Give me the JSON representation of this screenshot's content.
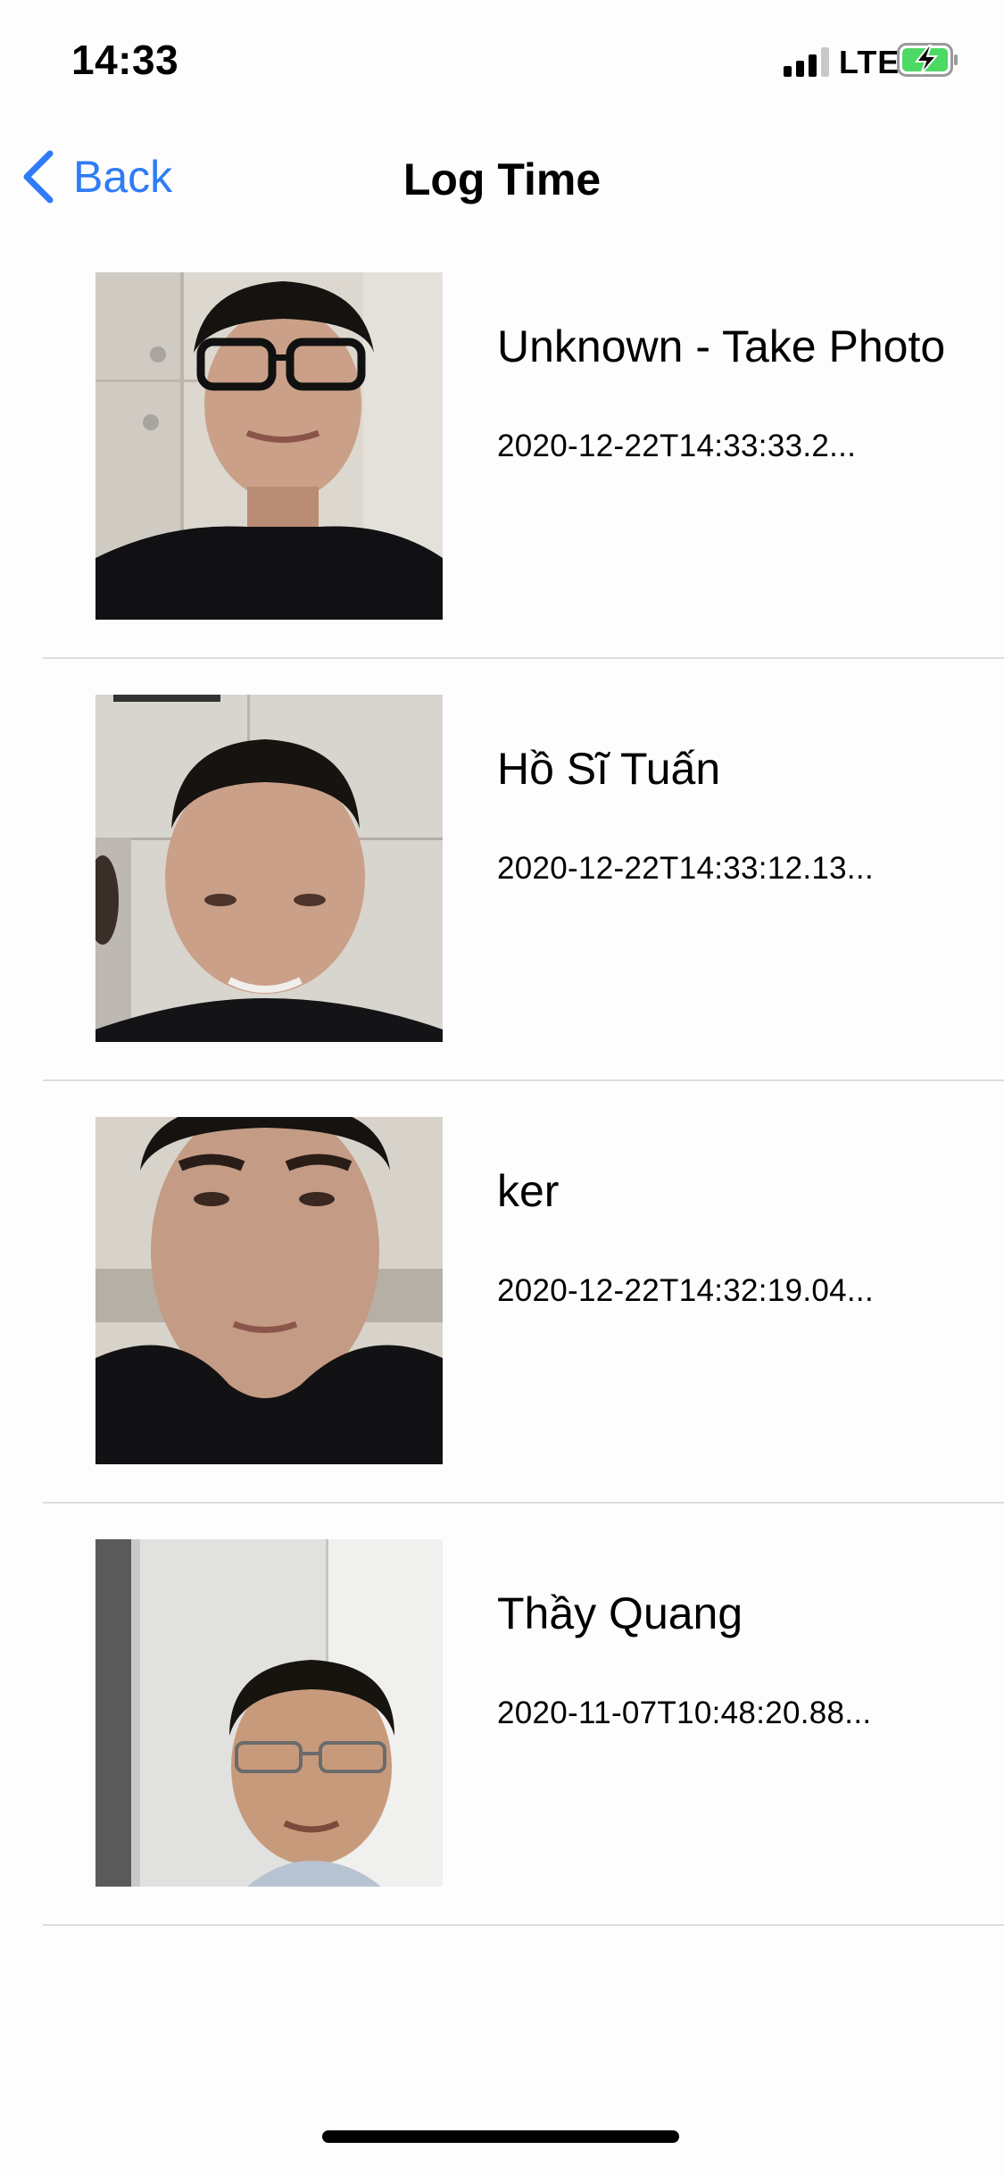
{
  "status_bar": {
    "time": "14:33",
    "network": "LTE",
    "signal_bars_active": 3,
    "battery_state": "charging",
    "battery_color": "#4cd964"
  },
  "nav": {
    "back_label": "Back",
    "back_icon": "chevron-left-icon",
    "title": "Log Time",
    "tint_color": "#2f7cf6"
  },
  "logs": [
    {
      "name": "Unknown - Take Photo",
      "time": "2020-12-22T14:33:33.2..."
    },
    {
      "name": "Hồ Sĩ Tuấn",
      "time": "2020-12-22T14:33:12.13..."
    },
    {
      "name": "ker",
      "time": "2020-12-22T14:32:19.04..."
    },
    {
      "name": "Thầy Quang",
      "time": "2020-11-07T10:48:20.88..."
    }
  ]
}
